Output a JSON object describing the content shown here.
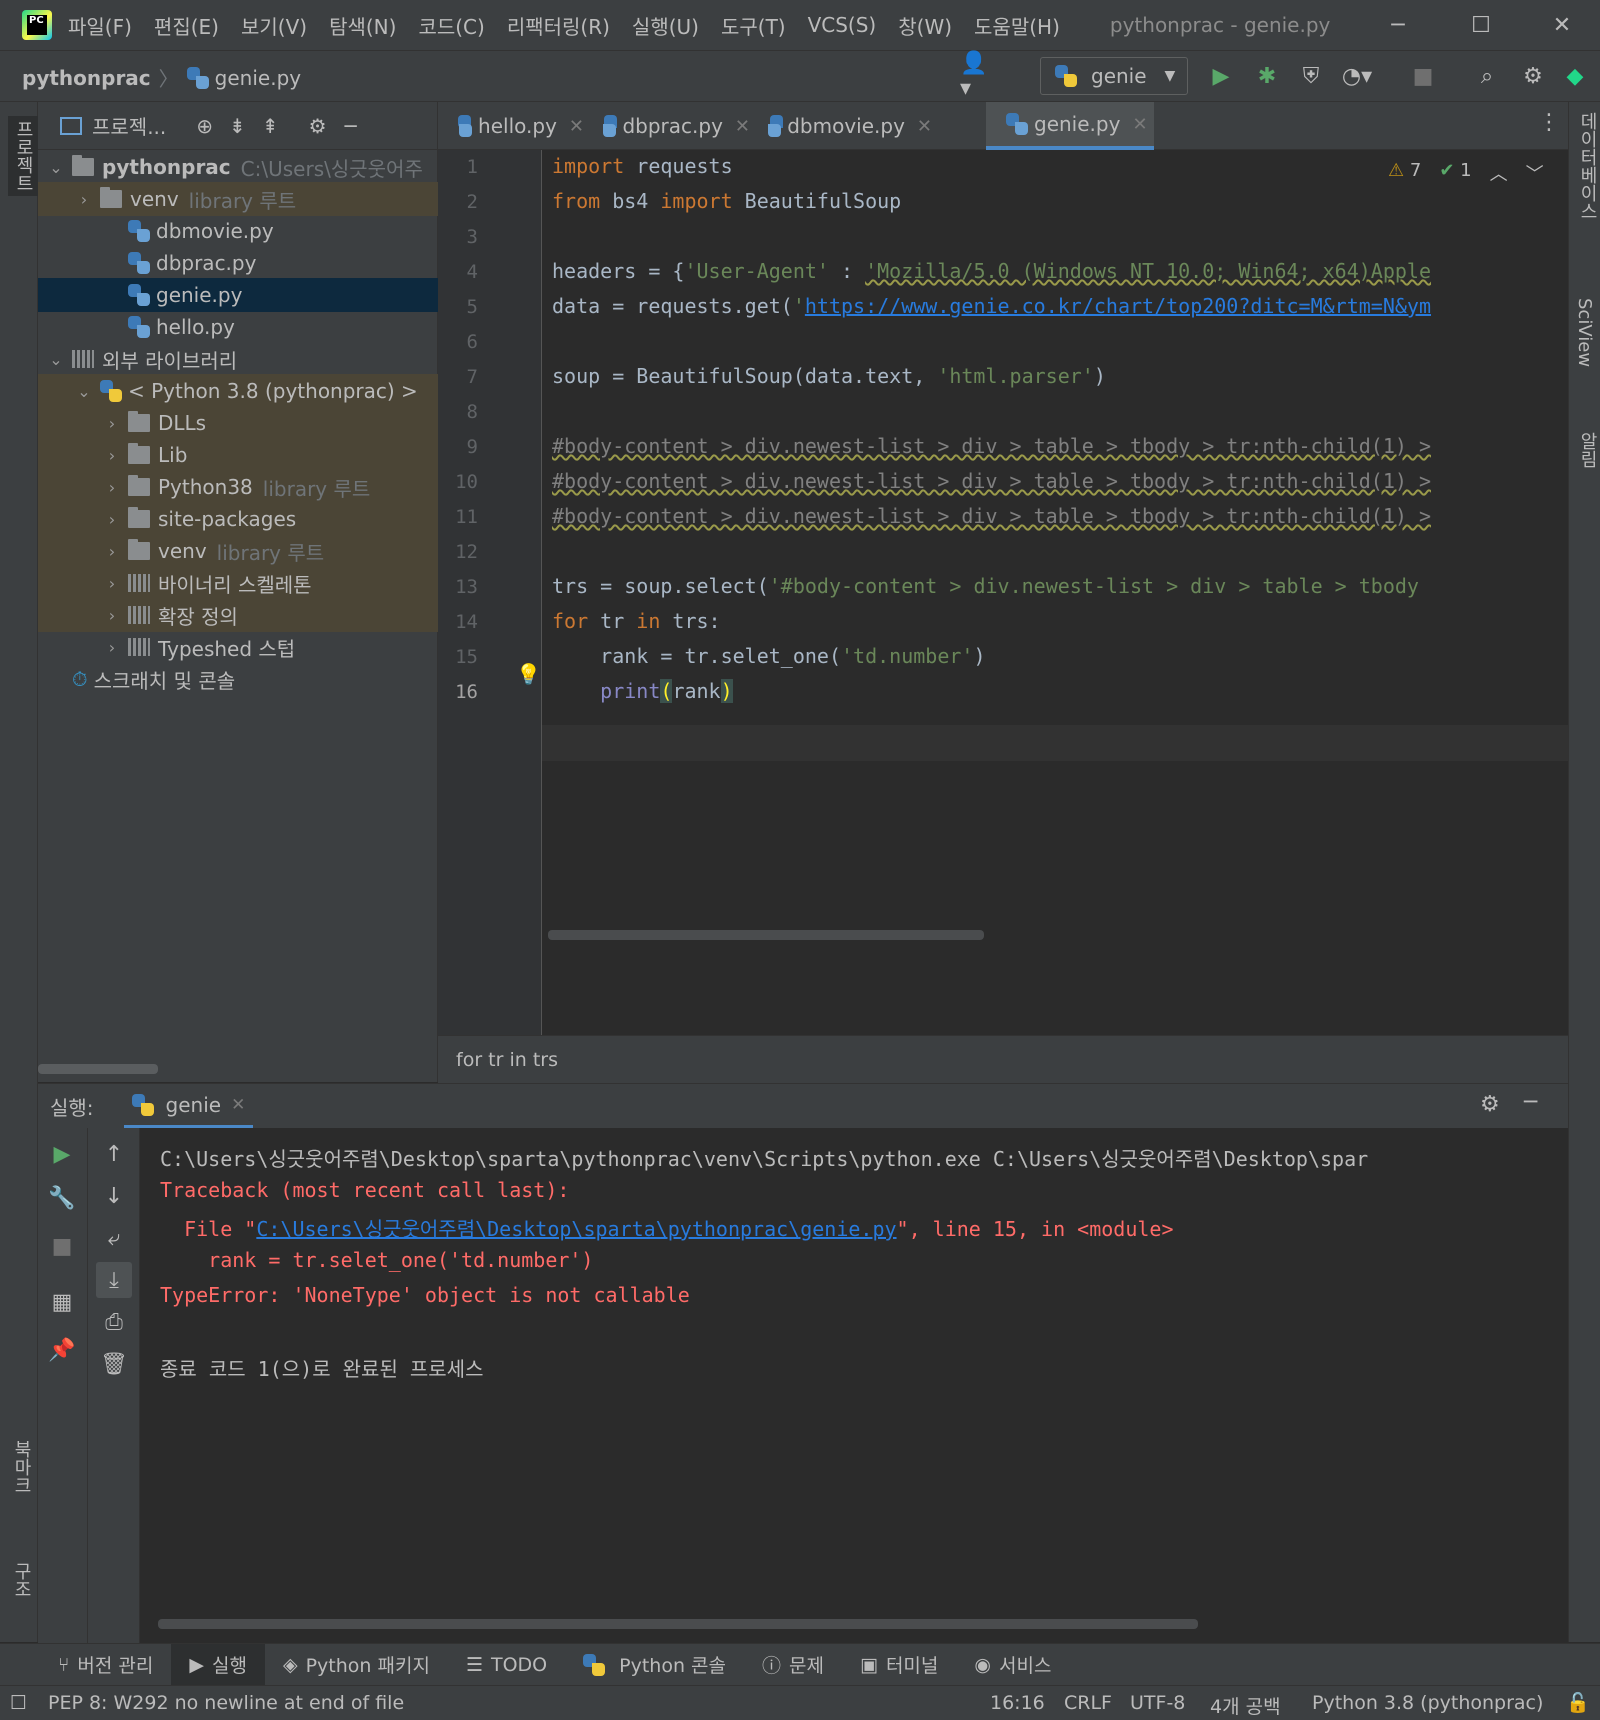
{
  "titlebar": {
    "menu": [
      "파일(F)",
      "편집(E)",
      "보기(V)",
      "탐색(N)",
      "코드(C)",
      "리팩터링(R)",
      "실행(U)",
      "도구(T)",
      "VCS(S)",
      "창(W)",
      "도움말(H)"
    ],
    "title": "pythonprac - genie.py",
    "logo_text": "PC"
  },
  "navbar": {
    "project": "pythonprac",
    "file": "genie.py",
    "run_config": "genie"
  },
  "left_strip": {
    "project_label": "프로젝트",
    "bookmarks_label": "북마크",
    "structure_label": "구조"
  },
  "right_strip": {
    "database_label": "데이터베이스",
    "sciview_label": "SciView",
    "notifications_label": "알림"
  },
  "project_panel": {
    "title": "프로젝...",
    "tree": [
      {
        "label": "pythonprac",
        "note": "C:\\Users\\싱긋웃어주",
        "indent": 0,
        "chev": "v",
        "type": "folder",
        "bold": true
      },
      {
        "label": "venv",
        "note": "library 루트",
        "indent": 1,
        "chev": ">",
        "type": "folder",
        "lib": true
      },
      {
        "label": "dbmovie.py",
        "note": "",
        "indent": 2,
        "chev": "",
        "type": "py"
      },
      {
        "label": "dbprac.py",
        "note": "",
        "indent": 2,
        "chev": "",
        "type": "py"
      },
      {
        "label": "genie.py",
        "note": "",
        "indent": 2,
        "chev": "",
        "type": "py",
        "selected": true
      },
      {
        "label": "hello.py",
        "note": "",
        "indent": 2,
        "chev": "",
        "type": "py"
      },
      {
        "label": "외부 라이브러리",
        "note": "",
        "indent": 0,
        "chev": "v",
        "type": "lib"
      },
      {
        "label": "< Python 3.8 (pythonprac) >",
        "note": "",
        "indent": 1,
        "chev": "v",
        "type": "python",
        "lib": true
      },
      {
        "label": "DLLs",
        "note": "",
        "indent": 2,
        "chev": ">",
        "type": "folder",
        "lib": true
      },
      {
        "label": "Lib",
        "note": "",
        "indent": 2,
        "chev": ">",
        "type": "folder",
        "lib": true
      },
      {
        "label": "Python38",
        "note": "library 루트",
        "indent": 2,
        "chev": ">",
        "type": "folder",
        "lib": true
      },
      {
        "label": "site-packages",
        "note": "",
        "indent": 2,
        "chev": ">",
        "type": "folder",
        "lib": true
      },
      {
        "label": "venv",
        "note": "library 루트",
        "indent": 2,
        "chev": ">",
        "type": "folder",
        "lib": true
      },
      {
        "label": "바이너리 스켈레톤",
        "note": "",
        "indent": 2,
        "chev": ">",
        "type": "lib",
        "lib": true
      },
      {
        "label": "확장 정의",
        "note": "",
        "indent": 2,
        "chev": ">",
        "type": "lib",
        "lib": true
      },
      {
        "label": "Typeshed 스텁",
        "note": "",
        "indent": 2,
        "chev": ">",
        "type": "lib"
      },
      {
        "label": "스크래치 및 콘솔",
        "note": "",
        "indent": 0,
        "chev": "",
        "type": "scratch"
      }
    ]
  },
  "tabs": [
    {
      "label": "hello.py",
      "active": false
    },
    {
      "label": "dbprac.py",
      "active": false
    },
    {
      "label": "dbmovie.py",
      "active": false
    },
    {
      "label": "genie.py",
      "active": true
    }
  ],
  "editor": {
    "warnings": "7",
    "weak_warnings": "1",
    "line_numbers": [
      "1",
      "2",
      "3",
      "4",
      "5",
      "6",
      "7",
      "8",
      "9",
      "10",
      "11",
      "12",
      "13",
      "14",
      "15",
      "16"
    ],
    "breadcrumb": "for tr in trs"
  },
  "run_panel": {
    "label": "실행:",
    "tab": "genie",
    "console": {
      "cmd": "C:\\Users\\싱긋웃어주렴\\Desktop\\sparta\\pythonprac\\venv\\Scripts\\python.exe C:\\Users\\싱긋웃어주렴\\Desktop\\spar",
      "traceback": "Traceback (most recent call last):",
      "file_prefix": "  File \"",
      "file_link": "C:\\Users\\싱긋웃어주렴\\Desktop\\sparta\\pythonprac\\genie.py",
      "file_suffix": "\", line 15, in <module>",
      "code_line": "    rank = tr.selet_one('td.number')",
      "error": "TypeError: 'NoneType' object is not callable",
      "exit": "종료 코드 1(으)로 완료된 프로세스"
    }
  },
  "bottom_tools": [
    "버전 관리",
    "실행",
    "Python 패키지",
    "TODO",
    "Python 콘솔",
    "문제",
    "터미널",
    "서비스"
  ],
  "statusbar": {
    "message": "PEP 8: W292 no newline at end of file",
    "position": "16:16",
    "line_sep": "CRLF",
    "encoding": "UTF-8",
    "indent": "4개 공백",
    "interpreter": "Python 3.8 (pythonprac)"
  },
  "colors": {
    "accent": "#4a88c7",
    "error": "#ff6b68",
    "keyword": "#cc7832",
    "string": "#6a8759",
    "link": "#287bde"
  }
}
